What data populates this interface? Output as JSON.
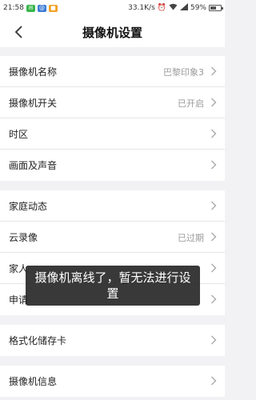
{
  "status_bar": {
    "time": "21:58",
    "speed": "33.1K/s",
    "battery": "59%",
    "battery_level": 0.59,
    "icons": [
      "app-notification-icon",
      "mail-icon",
      "app-icon",
      "alarm-icon",
      "wifi-icon",
      "signal-icon",
      "battery-icon"
    ]
  },
  "header": {
    "title": "摄像机设置"
  },
  "sections": [
    {
      "rows": [
        {
          "label": "摄像机名称",
          "value": "巴黎印象3"
        },
        {
          "label": "摄像机开关",
          "value": "已开启"
        },
        {
          "label": "时区",
          "value": ""
        },
        {
          "label": "画面及声音",
          "value": ""
        }
      ]
    },
    {
      "rows": [
        {
          "label": "家庭动态",
          "value": ""
        },
        {
          "label": "云录像",
          "value": "已过期"
        },
        {
          "label": "家人",
          "value": ""
        },
        {
          "label": "申请",
          "value": ""
        }
      ]
    },
    {
      "rows": [
        {
          "label": "格式化储存卡",
          "value": ""
        }
      ]
    },
    {
      "rows": [
        {
          "label": "摄像机信息",
          "value": ""
        }
      ]
    }
  ],
  "toast": {
    "message": "摄像机离线了，暂无法进行设置"
  },
  "colors": {
    "background": "#f2f2f4",
    "card": "#ffffff",
    "toast_bg": "#1e1e1e",
    "muted_text": "#999999"
  }
}
